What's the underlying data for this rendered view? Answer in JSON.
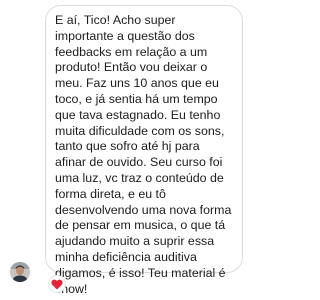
{
  "message": {
    "text": "E aí, Tico! Acho super importante a questão dos feedbacks em relação a um produto! Então vou deixar o meu. Faz uns 10 anos que eu toco, e já sentia há um tempo que tava estagnado. Eu tenho muita dificuldade com os sons, tanto que sofro até hj para afinar de ouvido. Seu curso foi uma luz, vc traz o conteúdo de forma direta, e eu tô desenvolvendo uma nova forma de pensar em musica, o que tá ajudando muito a suprir essa minha deficiência auditiva digamos, é isso! Teu material é show!"
  },
  "sender": {
    "avatar_icon": "user-avatar-photo"
  },
  "reaction": {
    "icon": "red-heart-icon",
    "color": "#e8243a"
  }
}
